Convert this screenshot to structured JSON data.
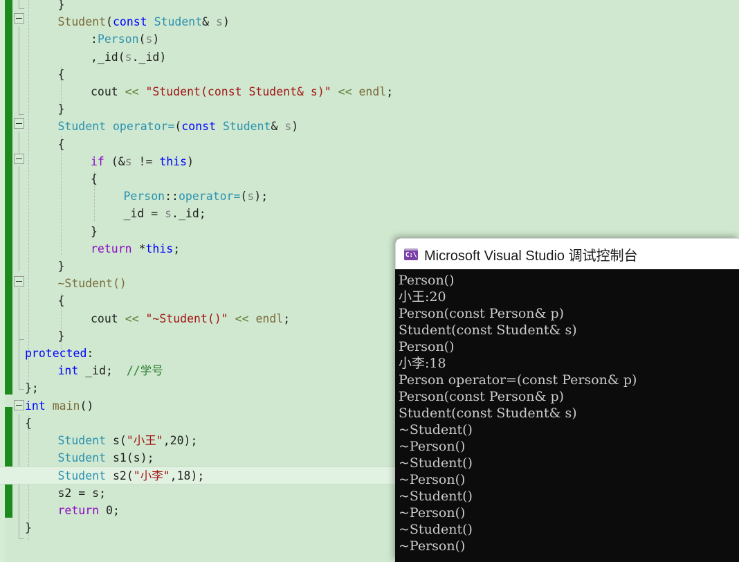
{
  "window": {
    "app": "Microsoft Visual Studio",
    "editor_background": "#cfe8cf",
    "change_bar_color": "#1c8a1c"
  },
  "editor": {
    "language": "C++",
    "current_line_index": 27,
    "lines": [
      {
        "indent": 1,
        "tokens": [
          {
            "t": "}",
            "c": "t-plain"
          }
        ]
      },
      {
        "indent": 1,
        "tokens": [
          {
            "t": "Student",
            "c": "t-ctor"
          },
          {
            "t": "(",
            "c": "t-plain"
          },
          {
            "t": "const",
            "c": "t-kw"
          },
          {
            "t": " ",
            "c": "t-plain"
          },
          {
            "t": "Student",
            "c": "t-type"
          },
          {
            "t": "& ",
            "c": "t-plain"
          },
          {
            "t": "s",
            "c": "t-var"
          },
          {
            "t": ")",
            "c": "t-plain"
          }
        ]
      },
      {
        "indent": 2,
        "tokens": [
          {
            "t": ":",
            "c": "t-plain"
          },
          {
            "t": "Person",
            "c": "t-type"
          },
          {
            "t": "(",
            "c": "t-plain"
          },
          {
            "t": "s",
            "c": "t-var"
          },
          {
            "t": ")",
            "c": "t-plain"
          }
        ]
      },
      {
        "indent": 2,
        "tokens": [
          {
            "t": ",_id(",
            "c": "t-plain"
          },
          {
            "t": "s",
            "c": "t-var"
          },
          {
            "t": "._id)",
            "c": "t-plain"
          }
        ]
      },
      {
        "indent": 1,
        "tokens": [
          {
            "t": "{",
            "c": "t-plain"
          }
        ]
      },
      {
        "indent": 2,
        "tokens": [
          {
            "t": "cout ",
            "c": "t-plain"
          },
          {
            "t": "<<",
            "c": "t-op"
          },
          {
            "t": " ",
            "c": "t-plain"
          },
          {
            "t": "\"Student(const Student& s)\"",
            "c": "t-str"
          },
          {
            "t": " ",
            "c": "t-plain"
          },
          {
            "t": "<<",
            "c": "t-op"
          },
          {
            "t": " ",
            "c": "t-plain"
          },
          {
            "t": "endl",
            "c": "t-ctor"
          },
          {
            "t": ";",
            "c": "t-plain"
          }
        ]
      },
      {
        "indent": 1,
        "tokens": [
          {
            "t": "}",
            "c": "t-plain"
          }
        ]
      },
      {
        "indent": 1,
        "tokens": [
          {
            "t": "Student",
            "c": "t-type"
          },
          {
            "t": " ",
            "c": "t-plain"
          },
          {
            "t": "operator=",
            "c": "t-type"
          },
          {
            "t": "(",
            "c": "t-plain"
          },
          {
            "t": "const",
            "c": "t-kw"
          },
          {
            "t": " ",
            "c": "t-plain"
          },
          {
            "t": "Student",
            "c": "t-type"
          },
          {
            "t": "& ",
            "c": "t-plain"
          },
          {
            "t": "s",
            "c": "t-var"
          },
          {
            "t": ")",
            "c": "t-plain"
          }
        ]
      },
      {
        "indent": 1,
        "tokens": [
          {
            "t": "{",
            "c": "t-plain"
          }
        ]
      },
      {
        "indent": 2,
        "tokens": [
          {
            "t": "if",
            "c": "t-ctrl"
          },
          {
            "t": " (&",
            "c": "t-plain"
          },
          {
            "t": "s",
            "c": "t-var"
          },
          {
            "t": " != ",
            "c": "t-plain"
          },
          {
            "t": "this",
            "c": "t-kw"
          },
          {
            "t": ")",
            "c": "t-plain"
          }
        ]
      },
      {
        "indent": 2,
        "tokens": [
          {
            "t": "{",
            "c": "t-plain"
          }
        ]
      },
      {
        "indent": 3,
        "tokens": [
          {
            "t": "Person",
            "c": "t-type"
          },
          {
            "t": "::",
            "c": "t-plain"
          },
          {
            "t": "operator=",
            "c": "t-type"
          },
          {
            "t": "(",
            "c": "t-plain"
          },
          {
            "t": "s",
            "c": "t-var"
          },
          {
            "t": ");",
            "c": "t-plain"
          }
        ]
      },
      {
        "indent": 3,
        "tokens": [
          {
            "t": "_id = ",
            "c": "t-plain"
          },
          {
            "t": "s",
            "c": "t-var"
          },
          {
            "t": "._id;",
            "c": "t-plain"
          }
        ]
      },
      {
        "indent": 2,
        "tokens": [
          {
            "t": "}",
            "c": "t-plain"
          }
        ]
      },
      {
        "indent": 2,
        "tokens": [
          {
            "t": "return",
            "c": "t-ctrl"
          },
          {
            "t": " *",
            "c": "t-plain"
          },
          {
            "t": "this",
            "c": "t-kw"
          },
          {
            "t": ";",
            "c": "t-plain"
          }
        ]
      },
      {
        "indent": 1,
        "tokens": [
          {
            "t": "}",
            "c": "t-plain"
          }
        ]
      },
      {
        "indent": 1,
        "tokens": [
          {
            "t": "~Student()",
            "c": "t-ctor"
          }
        ]
      },
      {
        "indent": 1,
        "tokens": [
          {
            "t": "{",
            "c": "t-plain"
          }
        ]
      },
      {
        "indent": 2,
        "tokens": [
          {
            "t": "cout ",
            "c": "t-plain"
          },
          {
            "t": "<<",
            "c": "t-op"
          },
          {
            "t": " ",
            "c": "t-plain"
          },
          {
            "t": "\"~Student()\"",
            "c": "t-str"
          },
          {
            "t": " ",
            "c": "t-plain"
          },
          {
            "t": "<<",
            "c": "t-op"
          },
          {
            "t": " ",
            "c": "t-plain"
          },
          {
            "t": "endl",
            "c": "t-ctor"
          },
          {
            "t": ";",
            "c": "t-plain"
          }
        ]
      },
      {
        "indent": 1,
        "tokens": [
          {
            "t": "}",
            "c": "t-plain"
          }
        ]
      },
      {
        "indent": 0,
        "tokens": [
          {
            "t": "protected",
            "c": "t-kw"
          },
          {
            "t": ":",
            "c": "t-plain"
          }
        ]
      },
      {
        "indent": 1,
        "tokens": [
          {
            "t": "int",
            "c": "t-kw"
          },
          {
            "t": " _id;  ",
            "c": "t-plain"
          },
          {
            "t": "//学号",
            "c": "t-cmt"
          }
        ]
      },
      {
        "indent": 0,
        "tokens": [
          {
            "t": "};",
            "c": "t-plain"
          }
        ]
      },
      {
        "indent": 0,
        "tokens": [
          {
            "t": "int",
            "c": "t-kw"
          },
          {
            "t": " ",
            "c": "t-plain"
          },
          {
            "t": "main",
            "c": "t-fn"
          },
          {
            "t": "()",
            "c": "t-plain"
          }
        ]
      },
      {
        "indent": 0,
        "tokens": [
          {
            "t": "{",
            "c": "t-plain"
          }
        ]
      },
      {
        "indent": 1,
        "tokens": [
          {
            "t": "Student",
            "c": "t-type"
          },
          {
            "t": " s(",
            "c": "t-plain"
          },
          {
            "t": "\"小王\"",
            "c": "t-str"
          },
          {
            "t": ",20);",
            "c": "t-plain"
          }
        ]
      },
      {
        "indent": 1,
        "tokens": [
          {
            "t": "Student",
            "c": "t-type"
          },
          {
            "t": " s1(s);",
            "c": "t-plain"
          }
        ]
      },
      {
        "indent": 1,
        "tokens": [
          {
            "t": "Student",
            "c": "t-type"
          },
          {
            "t": " s2(",
            "c": "t-plain"
          },
          {
            "t": "\"小李\"",
            "c": "t-str"
          },
          {
            "t": ",18);",
            "c": "t-plain"
          }
        ]
      },
      {
        "indent": 1,
        "tokens": [
          {
            "t": "s2 = s;",
            "c": "t-plain"
          }
        ]
      },
      {
        "indent": 1,
        "tokens": [
          {
            "t": "return",
            "c": "t-ctrl"
          },
          {
            "t": " 0;",
            "c": "t-plain"
          }
        ]
      },
      {
        "indent": 0,
        "tokens": [
          {
            "t": "}",
            "c": "t-plain"
          }
        ]
      }
    ]
  },
  "console": {
    "title": "Microsoft Visual Studio 调试控制台",
    "icon_label": "C:\\",
    "icon_name": "command-prompt-icon",
    "background": "#0c0c0c",
    "foreground": "#cccccc",
    "output": [
      "Person()",
      "小王:20",
      "Person(const Person& p)",
      "Student(const Student& s)",
      "Person()",
      "小李:18",
      "Person operator=(const Person& p)",
      "Person(const Person& p)",
      "Student(const Student& s)",
      "~Student()",
      "~Person()",
      "~Student()",
      "~Person()",
      "~Student()",
      "~Person()",
      "~Student()",
      "~Person()"
    ]
  }
}
